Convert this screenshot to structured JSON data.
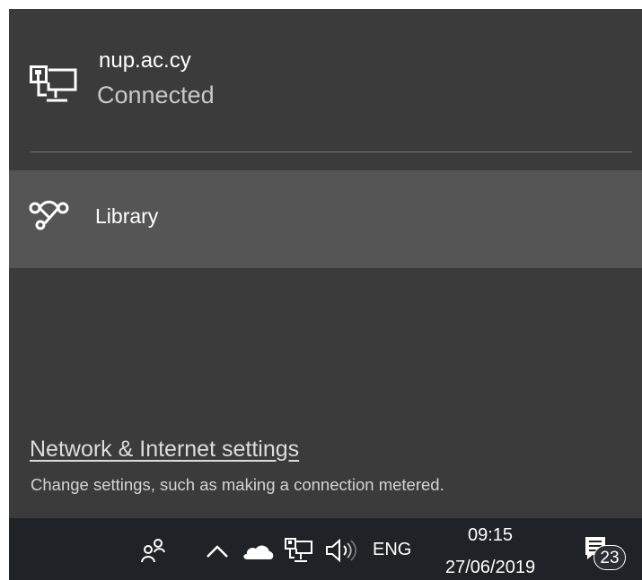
{
  "flyout": {
    "connection": {
      "name": "nup.ac.cy",
      "status": "Connected",
      "icon": "wired-network-icon"
    },
    "wifi_network": {
      "name": "Library",
      "icon": "wifi-direct-network-icon"
    },
    "settings_link": "Network & Internet settings",
    "settings_description": "Change settings, such as making a connection metered."
  },
  "taskbar": {
    "language": "ENG",
    "time": "09:15",
    "date": "27/06/2019",
    "notifications_count": "23",
    "icons": [
      "people-icon",
      "chevron-up-icon",
      "cloud-icon",
      "network-icon",
      "volume-icon",
      "notification-center-icon"
    ]
  },
  "colors": {
    "flyout_background": "#3b3b3b",
    "selected_row": "#555555",
    "taskbar_background": "#1f2328",
    "text_primary": "#ffffff",
    "text_secondary": "#c9c9c9"
  }
}
